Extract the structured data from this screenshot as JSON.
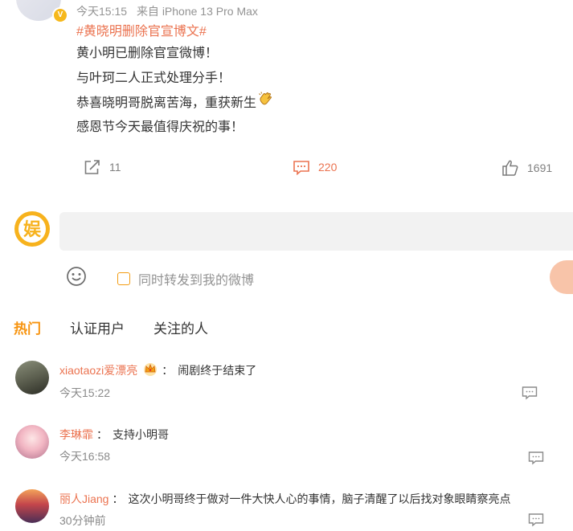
{
  "post": {
    "time": "今天15:15",
    "source": "来自 iPhone 13 Pro Max",
    "hashtag": "#黄晓明删除官宣博文#",
    "lines": [
      "黄小明已删除官宣微博！",
      "与叶珂二人正式处理分手！",
      "恭喜晓明哥脱离苦海，重获新生",
      "感恩节今天最值得庆祝的事！"
    ],
    "emoji": "clapping-hands-emoji"
  },
  "actions": {
    "repost_count": "11",
    "comment_count": "220",
    "like_count": "1691",
    "accent": "#eb7350"
  },
  "composer": {
    "avatar_label": "娱",
    "input_placeholder": "",
    "forward_label": "同时转发到我的微博"
  },
  "tabs": [
    {
      "label": "热门",
      "active": true
    },
    {
      "label": "认证用户",
      "active": false
    },
    {
      "label": "关注的人",
      "active": false
    }
  ],
  "comments": [
    {
      "user": "xiaotaozi爱漂亮",
      "badge": "crown-icon",
      "text": "闹剧终于结束了",
      "time": "今天15:22"
    },
    {
      "user": "李琳霏",
      "text": "支持小明哥",
      "time": "今天16:58"
    },
    {
      "user": "丽人Jiang",
      "text": "这次小明哥终于做对一件大快人心的事情，脑子清醒了以后找对象眼睛察亮点",
      "time": "30分钟前"
    }
  ]
}
